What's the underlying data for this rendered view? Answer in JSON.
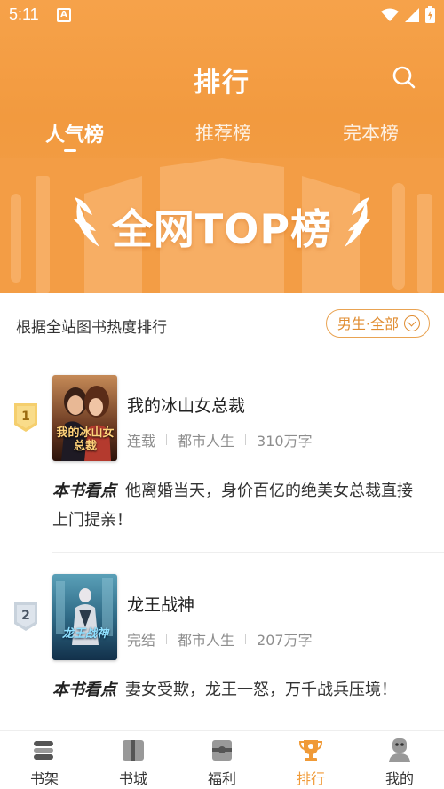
{
  "status": {
    "time": "5:11",
    "app_badge": "A"
  },
  "header": {
    "title": "排行",
    "tabs": [
      {
        "label": "人气榜",
        "active": true
      },
      {
        "label": "推荐榜",
        "active": false
      },
      {
        "label": "完本榜",
        "active": false
      }
    ],
    "banner_text": "全网TOP榜"
  },
  "filter": {
    "description": "根据全站图书热度排行",
    "button_label": "男生·全部"
  },
  "books": [
    {
      "rank": "1",
      "title": "我的冰山女总裁",
      "status": "连载",
      "category": "都市人生",
      "words": "310万字",
      "blurb_label": "本书看点",
      "blurb": "他离婚当天，身价百亿的绝美女总裁直接上门提亲！",
      "cover_title": "我的冰山女总裁"
    },
    {
      "rank": "2",
      "title": "龙王战神",
      "status": "完结",
      "category": "都市人生",
      "words": "207万字",
      "blurb_label": "本书看点",
      "blurb": "妻女受欺，龙王一怒，万千战兵压境！",
      "cover_title": "龙王战神"
    }
  ],
  "nav": [
    {
      "label": "书架",
      "icon": "bookshelf-icon",
      "active": false
    },
    {
      "label": "书城",
      "icon": "book-store-icon",
      "active": false
    },
    {
      "label": "福利",
      "icon": "welfare-icon",
      "active": false
    },
    {
      "label": "排行",
      "icon": "trophy-icon",
      "active": true
    },
    {
      "label": "我的",
      "icon": "profile-icon",
      "active": false
    }
  ],
  "colors": {
    "accent": "#f09a37",
    "header_bg": "#f29a3f"
  }
}
